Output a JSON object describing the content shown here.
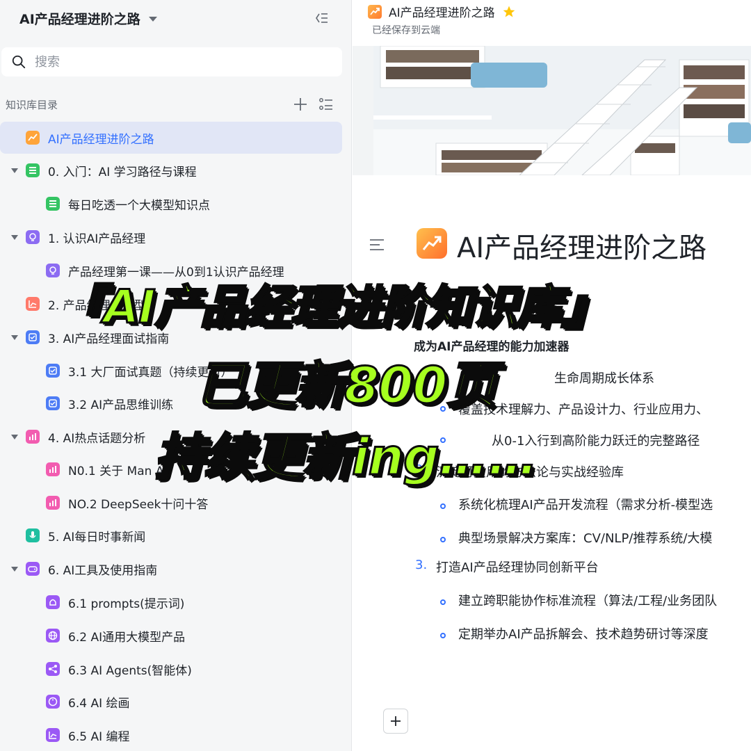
{
  "sidebar": {
    "title": "AI产品经理进阶之路",
    "search_placeholder": "搜索",
    "directory_label": "知识库目录",
    "items": [
      {
        "label": "AI产品经理进阶之路",
        "icon": "trend-chart-icon",
        "color": "#ffa43a"
      },
      {
        "label": "0. 入门：AI 学习路径与课程",
        "icon": "sheet-icon",
        "color": "#34c463"
      },
      {
        "label": "每日吃透一个大模型知识点",
        "icon": "sheet-icon",
        "color": "#34c463"
      },
      {
        "label": "1. 认识AI产品经理",
        "icon": "lightbulb-icon",
        "color": "#8c6cf2"
      },
      {
        "label": "产品经理第一课——从0到1认识产品经理",
        "icon": "lightbulb-icon",
        "color": "#8c6cf2"
      },
      {
        "label": "2. 产品经理常用型",
        "icon": "chart-icon",
        "color": "#ff7a6b"
      },
      {
        "label": "3. AI产品经理面试指南",
        "icon": "check-icon",
        "color": "#4d7cf5"
      },
      {
        "label": "3.1 大厂面试真题（持续更新）",
        "icon": "check-icon",
        "color": "#4d7cf5"
      },
      {
        "label": "3.2 AI产品思维训练",
        "icon": "check-icon",
        "color": "#4d7cf5"
      },
      {
        "label": "4. AI热点话题分析",
        "icon": "bar-chart-icon",
        "color": "#f25cb0"
      },
      {
        "label": "N0.1 关于 Man  AI",
        "icon": "bar-chart-icon",
        "color": "#f25cb0"
      },
      {
        "label": "NO.2 DeepSeek十问十答",
        "icon": "bar-chart-icon",
        "color": "#f25cb0"
      },
      {
        "label": "5. AI每日时事新闻",
        "icon": "microphone-icon",
        "color": "#1fbfa0"
      },
      {
        "label": "6. AI工具及使用指南",
        "icon": "gamepad-icon",
        "color": "#9b59f5"
      },
      {
        "label": "6.1 prompts(提示词)",
        "icon": "bell-icon",
        "color": "#9b59f5"
      },
      {
        "label": "6.2 AI通用大模型产品",
        "icon": "globe-icon",
        "color": "#9b59f5"
      },
      {
        "label": "6.3 AI Agents(智能体)",
        "icon": "share-icon",
        "color": "#9b59f5"
      },
      {
        "label": "6.4 AI 绘画",
        "icon": "palette-icon",
        "color": "#9b59f5"
      },
      {
        "label": "6.5 AI 编程",
        "icon": "chart-icon",
        "color": "#9b59f5"
      }
    ]
  },
  "main": {
    "doc_name": "AI产品经理进阶之路",
    "save_status": "已经保存到云端",
    "page_title": "AI产品经理进阶之路",
    "subheading": "成为AI产品经理的能力加速器",
    "lines": {
      "l1": "生命周期成长体系",
      "l1a": "覆盖技术理解力、产品设计力、行业应用力、",
      "l1b": "从0-1入行到高阶能力跃迁的完整路径",
      "l2_num": "2.",
      "l2": "沉淀可复用的方法论与实战经验库",
      "l2a": "系统化梳理AI产品开发流程（需求分析-模型选",
      "l2b": "典型场景解决方案库：CV/NLP/推荐系统/大模",
      "l3_num": "3.",
      "l3": "打造AI产品经理协同创新平台",
      "l3a": "建立跨职能协作标准流程（算法/工程/业务团队",
      "l3b": "定期举办AI产品拆解会、技术趋势研讨等深度"
    }
  },
  "overlay": {
    "line1": "『AI产品经理进阶知识库』",
    "line2": "已更新800页",
    "line3": "持续更新ing……"
  },
  "colors": {
    "accent": "#3370ff",
    "overlay_green": "#a6ff1f",
    "active_bg": "#e1e6f6"
  }
}
